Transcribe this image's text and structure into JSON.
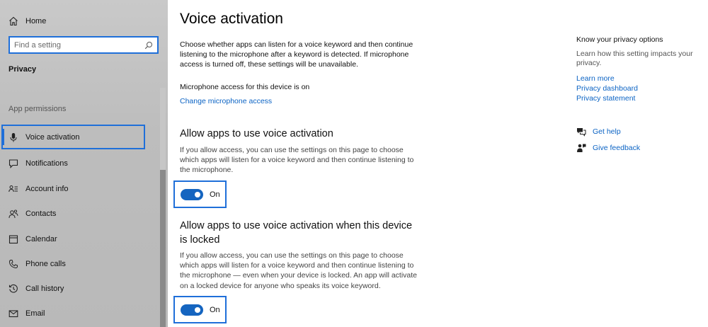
{
  "sidebar": {
    "home_label": "Home",
    "search_placeholder": "Find a setting",
    "section_title": "Privacy",
    "group_title": "App permissions",
    "items": [
      {
        "label": "Voice activation",
        "icon": "microphone-icon"
      },
      {
        "label": "Notifications",
        "icon": "notification-icon"
      },
      {
        "label": "Account info",
        "icon": "account-info-icon"
      },
      {
        "label": "Contacts",
        "icon": "contacts-icon"
      },
      {
        "label": "Calendar",
        "icon": "calendar-icon"
      },
      {
        "label": "Phone calls",
        "icon": "phone-icon"
      },
      {
        "label": "Call history",
        "icon": "history-icon"
      },
      {
        "label": "Email",
        "icon": "email-icon"
      }
    ]
  },
  "main": {
    "title": "Voice activation",
    "description": "Choose whether apps can listen for a voice keyword and then continue listening to the microphone after a keyword is detected. If microphone access is turned off, these settings will be unavailable.",
    "mic_status": "Microphone access for this device is on",
    "mic_link": "Change microphone access",
    "section1": {
      "heading": "Allow apps to use voice activation",
      "text": "If you allow access, you can use the settings on this page to choose which apps will listen for a voice keyword and then continue listening to the microphone.",
      "toggle_state": "On"
    },
    "section2": {
      "heading": "Allow apps to use voice activation when this device is locked",
      "text": "If you allow access, you can use the settings on this page to choose which apps will listen for a voice keyword and then continue listening to the microphone — even when your device is locked. An app will activate on a locked device for anyone who speaks its voice keyword.",
      "toggle_state": "On"
    }
  },
  "right": {
    "title": "Know your privacy options",
    "description": "Learn how this setting impacts your privacy.",
    "links": [
      "Learn more",
      "Privacy dashboard",
      "Privacy statement"
    ],
    "get_help": "Get help",
    "give_feedback": "Give feedback"
  },
  "colors": {
    "accent": "#1f6fd9",
    "toggle_on": "#1565c0",
    "link": "#0b63c4",
    "sidebar_bg": "#c2c2c2"
  }
}
